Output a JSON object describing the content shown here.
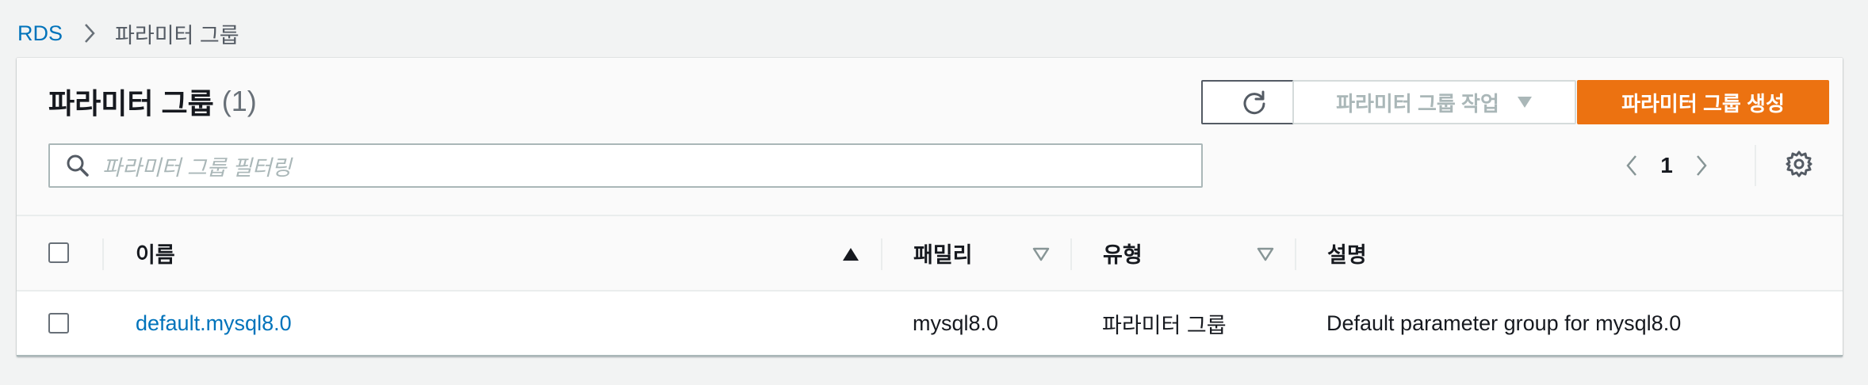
{
  "breadcrumb": {
    "root": "RDS",
    "current": "파라미터 그룹"
  },
  "panel": {
    "title": "파라미터 그룹",
    "count": "(1)",
    "actions_label": "파라미터 그룹 작업",
    "create_label": "파라미터 그룹 생성",
    "refresh_icon": "refresh-icon"
  },
  "search": {
    "placeholder": "파라미터 그룹 필터링"
  },
  "pagination": {
    "current_page": "1"
  },
  "table": {
    "columns": [
      {
        "label": "이름",
        "sort": "ascending"
      },
      {
        "label": "패밀리",
        "sort": "sortable"
      },
      {
        "label": "유형",
        "sort": "sortable"
      },
      {
        "label": "설명",
        "sort": "none"
      }
    ],
    "rows": [
      {
        "name": "default.mysql8.0",
        "family": "mysql8.0",
        "type": "파라미터 그룹",
        "description": "Default parameter group for mysql8.0",
        "selected": false
      }
    ]
  },
  "colors": {
    "accent_orange": "#ec7211",
    "link_blue": "#0073bb",
    "background": "#f2f3f3"
  }
}
